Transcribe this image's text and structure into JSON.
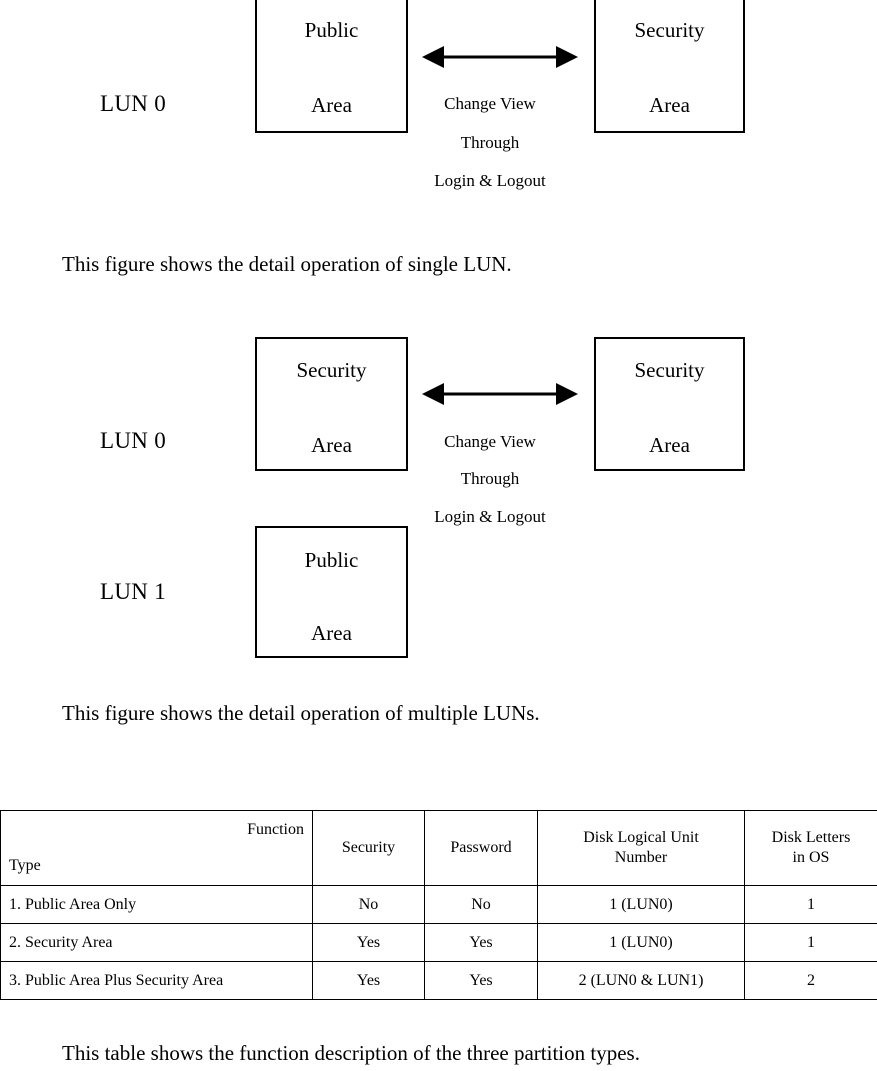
{
  "figure1": {
    "lun_label": "LUN 0",
    "left_box": {
      "line1": "Public",
      "line2": "Area"
    },
    "right_box": {
      "line1": "Security",
      "line2": "Area"
    },
    "arrow": {
      "icon": "double-headed-horizontal-arrow",
      "note_line1": "Change View",
      "note_line2": "Through",
      "note_line3": "Login & Logout"
    },
    "caption": "This figure shows the detail operation of single LUN."
  },
  "figure2": {
    "lun0_label": "LUN 0",
    "lun1_label": "LUN 1",
    "lun0_left_box": {
      "line1": "Security",
      "line2": "Area"
    },
    "lun0_right_box": {
      "line1": "Security",
      "line2": "Area"
    },
    "lun1_box": {
      "line1": "Public",
      "line2": "Area"
    },
    "arrow": {
      "icon": "double-headed-horizontal-arrow",
      "note_line1": "Change View",
      "note_line2": "Through",
      "note_line3": "Login & Logout"
    },
    "caption": "This figure shows the detail operation of multiple LUNs."
  },
  "table": {
    "corner_function_label": "Function",
    "corner_type_label": "Type",
    "headers": [
      "Security",
      "Password",
      "Disk Logical Unit Number",
      "Disk Letters in OS"
    ],
    "header_lines": [
      {
        "l1": "Security",
        "l2": ""
      },
      {
        "l1": "Password",
        "l2": ""
      },
      {
        "l1": "Disk Logical Unit",
        "l2": "Number"
      },
      {
        "l1": "Disk Letters",
        "l2": "in OS"
      }
    ],
    "rows": [
      {
        "type": "1. Public Area Only",
        "security": "No",
        "password": "No",
        "lun": "1 (LUN0)",
        "letters": "1"
      },
      {
        "type": "2. Security Area",
        "security": "Yes",
        "password": "Yes",
        "lun": "1 (LUN0)",
        "letters": "1"
      },
      {
        "type": "3. Public Area Plus Security Area",
        "security": "Yes",
        "password": "Yes",
        "lun": "2 (LUN0 & LUN1)",
        "letters": "2"
      }
    ],
    "caption": "This table shows the function description of the three partition types."
  },
  "colors": {
    "ink": "#000000",
    "paper": "#ffffff"
  }
}
